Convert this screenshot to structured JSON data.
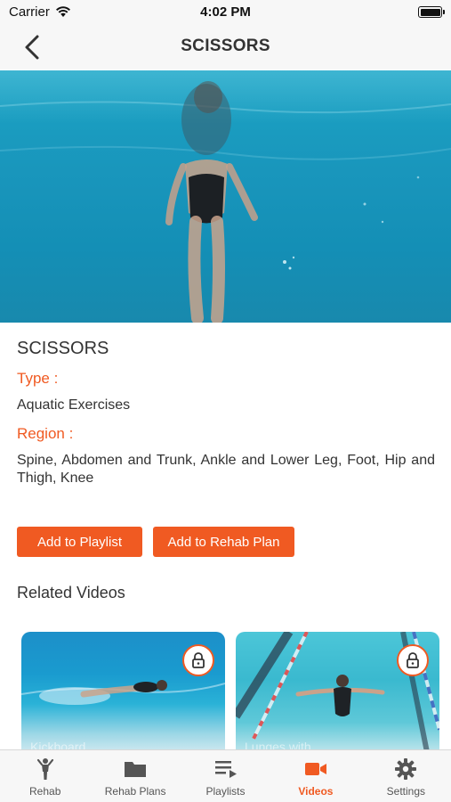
{
  "status_bar": {
    "carrier": "Carrier",
    "time": "4:02 PM"
  },
  "nav": {
    "title": "SCISSORS"
  },
  "exercise": {
    "title": "SCISSORS",
    "type_label": "Type :",
    "type_value": "Aquatic Exercises",
    "region_label": "Region :",
    "region_value": "Spine, Abdomen and Trunk, Ankle and Lower Leg, Foot, Hip and Thigh, Knee"
  },
  "buttons": {
    "add_playlist": "Add to Playlist",
    "add_rehab_plan": "Add to Rehab Plan"
  },
  "related": {
    "title": "Related Videos",
    "videos": [
      {
        "caption": "Kickboard ...",
        "locked": true
      },
      {
        "caption": "Lunges with ...",
        "locked": true
      }
    ]
  },
  "tabs": [
    {
      "label": "Rehab",
      "icon": "person-icon",
      "active": false
    },
    {
      "label": "Rehab Plans",
      "icon": "folder-icon",
      "active": false
    },
    {
      "label": "Playlists",
      "icon": "playlist-icon",
      "active": false
    },
    {
      "label": "Videos",
      "icon": "video-camera-icon",
      "active": true
    },
    {
      "label": "Settings",
      "icon": "gear-icon",
      "active": false
    }
  ],
  "colors": {
    "accent": "#f05a22",
    "text": "#333333",
    "bar_bg": "#f7f7f7",
    "tab_inactive": "#555555"
  }
}
